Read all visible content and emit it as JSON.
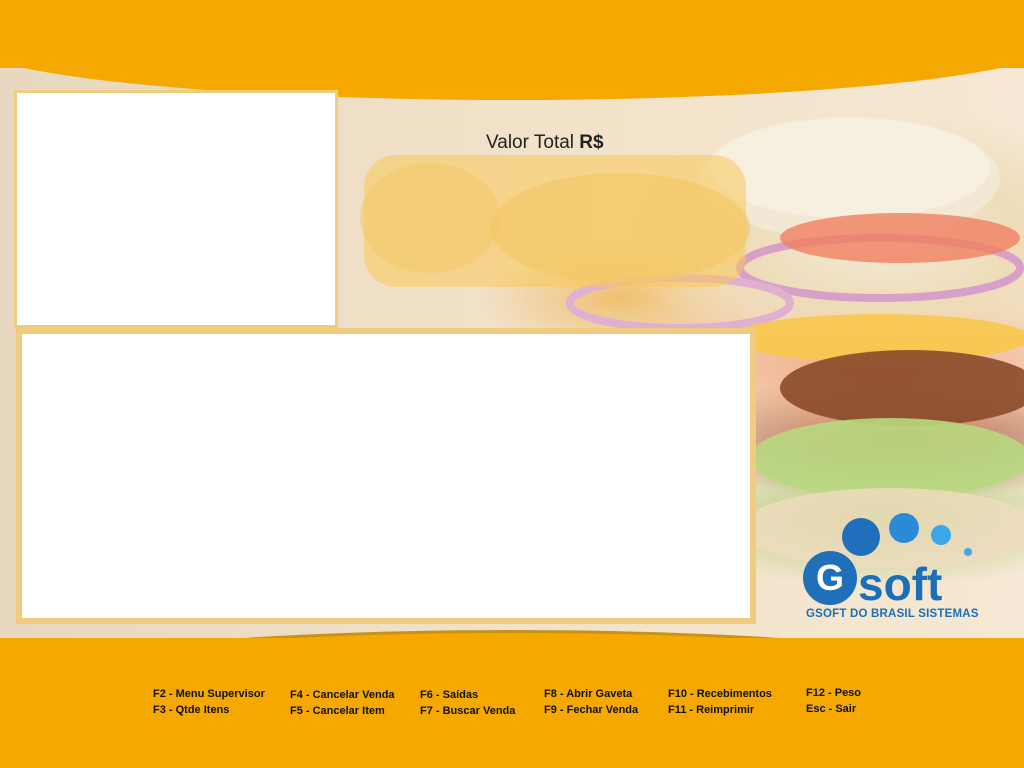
{
  "total": {
    "label_prefix": "Valor Total",
    "label_currency": "R$"
  },
  "branding": {
    "logo_text": "soft",
    "company": "GSOFT DO BRASIL SISTEMAS",
    "primary_color": "#1a6fb8",
    "accent_color": "#f5a800"
  },
  "shortcuts": [
    [
      "F2 - Menu Supervisor",
      "F3 - Qtde Itens"
    ],
    [
      "F4 - Cancelar Venda",
      "F5 - Cancelar Item"
    ],
    [
      "F6 - Saídas",
      "F7 - Buscar Venda"
    ],
    [
      "F8 - Abrir Gaveta",
      "F9 - Fechar Venda"
    ],
    [
      "F10 - Recebimentos",
      "F11 - Reimprimir"
    ],
    [
      "F12 - Peso",
      "Esc - Sair"
    ]
  ]
}
